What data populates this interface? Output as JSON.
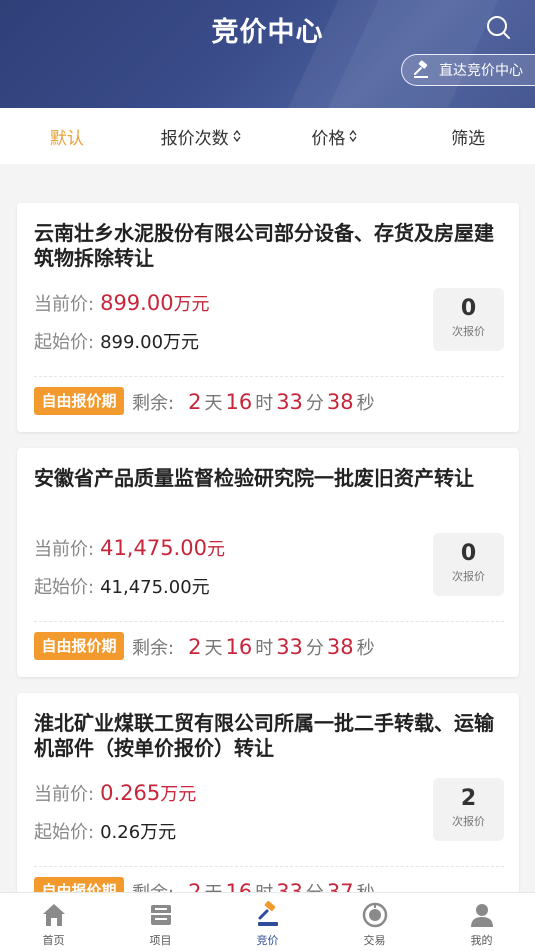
{
  "header": {
    "title": "竞价中心",
    "direct_label": "直达竞价中心"
  },
  "filters": [
    {
      "label": "默认",
      "active": true
    },
    {
      "label": "报价次数",
      "sortable": true
    },
    {
      "label": "价格",
      "sortable": true
    },
    {
      "label": "筛选"
    }
  ],
  "labels": {
    "current_price": "当前价:",
    "start_price": "起始价:",
    "bid_unit": "次报价",
    "remaining": "剩余:",
    "day": "天",
    "hour": "时",
    "minute": "分",
    "second": "秒"
  },
  "auctions": [
    {
      "title": "云南壮乡水泥股份有限公司部分设备、存货及房屋建筑物拆除转让",
      "current_price": "899.00",
      "current_unit": "万元",
      "start_price": "899.00万元",
      "bid_count": "0",
      "tag": "自由报价期",
      "days": "2",
      "hours": "16",
      "minutes": "33",
      "seconds": "38"
    },
    {
      "title": "安徽省产品质量监督检验研究院一批废旧资产转让",
      "current_price": "41,475.00",
      "current_unit": "元",
      "start_price": "41,475.00元",
      "bid_count": "0",
      "tag": "自由报价期",
      "days": "2",
      "hours": "16",
      "minutes": "33",
      "seconds": "38"
    },
    {
      "title": "淮北矿业煤联工贸有限公司所属一批二手转载、运输机部件（按单价报价）转让",
      "current_price": "0.265",
      "current_unit": "万元",
      "start_price": "0.26万元",
      "bid_count": "2",
      "tag": "自由报价期",
      "days": "2",
      "hours": "16",
      "minutes": "33",
      "seconds": "37"
    }
  ],
  "nav": [
    {
      "label": "首页",
      "icon": "home-icon"
    },
    {
      "label": "项目",
      "icon": "project-icon"
    },
    {
      "label": "竞价",
      "icon": "auction-icon",
      "active": true
    },
    {
      "label": "交易",
      "icon": "trade-icon"
    },
    {
      "label": "我的",
      "icon": "user-icon"
    }
  ],
  "colors": {
    "accent": "#e8a23a",
    "price_red": "#c7263a",
    "header_blue": "#3a4c8a",
    "tag_orange": "#f29a2e"
  }
}
